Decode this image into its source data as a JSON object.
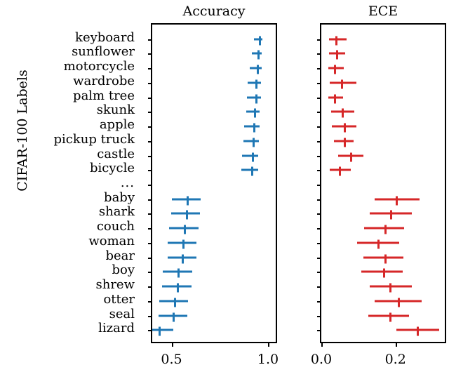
{
  "figure": {
    "ylabel": "CIFAR-100 Labels",
    "background": "#ffffff"
  },
  "panels": [
    {
      "id": "accuracy",
      "title": "Accuracy",
      "color": "#1f77b4",
      "xlim": [
        0.4,
        1.04
      ],
      "xticks": [
        0.5,
        1.0
      ],
      "xticklabels": [
        "0.5",
        "1.0"
      ]
    },
    {
      "id": "ece",
      "title": "ECE",
      "color": "#d62728",
      "xlim": [
        0.0,
        0.333
      ],
      "xticks": [
        0.0,
        0.2
      ],
      "xticklabels": [
        "0.0",
        "0.2"
      ]
    }
  ],
  "chart_data": {
    "type": "scatter",
    "title": "",
    "subtitle": "",
    "ylabel": "CIFAR-100 Labels",
    "xlabel": "",
    "grid": false,
    "legend": null,
    "orientation": "horizontal",
    "marker": "errorbar-with-center-cap",
    "categories": [
      "keyboard",
      "sunflower",
      "motorcycle",
      "wardrobe",
      "palm tree",
      "skunk",
      "apple",
      "pickup truck",
      "castle",
      "bicycle",
      "...",
      "baby",
      "shark",
      "couch",
      "woman",
      "bear",
      "boy",
      "shrew",
      "otter",
      "seal",
      "lizard"
    ],
    "gap_after_index": 9,
    "panels": [
      {
        "name": "Accuracy",
        "color": "#1f77b4",
        "xlim": [
          0.4,
          1.04
        ],
        "xticks": [
          0.5,
          1.0
        ],
        "xticklabels": [
          "0.5",
          "1.0"
        ],
        "points": [
          {
            "label": "keyboard",
            "value": 0.953,
            "low": 0.928,
            "high": 0.971
          },
          {
            "label": "sunflower",
            "value": 0.947,
            "low": 0.918,
            "high": 0.968
          },
          {
            "label": "motorcycle",
            "value": 0.943,
            "low": 0.906,
            "high": 0.966
          },
          {
            "label": "wardrobe",
            "value": 0.935,
            "low": 0.893,
            "high": 0.962
          },
          {
            "label": "palm tree",
            "value": 0.934,
            "low": 0.89,
            "high": 0.963
          },
          {
            "label": "skunk",
            "value": 0.929,
            "low": 0.887,
            "high": 0.958
          },
          {
            "label": "apple",
            "value": 0.924,
            "low": 0.875,
            "high": 0.955
          },
          {
            "label": "pickup truck",
            "value": 0.921,
            "low": 0.871,
            "high": 0.952
          },
          {
            "label": "castle",
            "value": 0.916,
            "low": 0.866,
            "high": 0.949
          },
          {
            "label": "bicycle",
            "value": 0.913,
            "low": 0.862,
            "high": 0.948
          },
          {
            "label": "baby",
            "value": 0.578,
            "low": 0.502,
            "high": 0.65
          },
          {
            "label": "shark",
            "value": 0.575,
            "low": 0.498,
            "high": 0.648
          },
          {
            "label": "couch",
            "value": 0.565,
            "low": 0.489,
            "high": 0.64
          },
          {
            "label": "woman",
            "value": 0.556,
            "low": 0.481,
            "high": 0.63
          },
          {
            "label": "bear",
            "value": 0.553,
            "low": 0.479,
            "high": 0.628
          },
          {
            "label": "boy",
            "value": 0.531,
            "low": 0.455,
            "high": 0.607
          },
          {
            "label": "shrew",
            "value": 0.526,
            "low": 0.451,
            "high": 0.602
          },
          {
            "label": "otter",
            "value": 0.511,
            "low": 0.437,
            "high": 0.587
          },
          {
            "label": "seal",
            "value": 0.505,
            "low": 0.431,
            "high": 0.581
          },
          {
            "label": "lizard",
            "value": 0.432,
            "low": 0.4,
            "high": 0.508
          }
        ]
      },
      {
        "name": "ECE",
        "color": "#d62728",
        "xlim": [
          0.0,
          0.333
        ],
        "xticks": [
          0.0,
          0.2
        ],
        "xticklabels": [
          "0.0",
          "0.2"
        ],
        "points": [
          {
            "label": "keyboard",
            "value": 0.037,
            "low": 0.02,
            "high": 0.069
          },
          {
            "label": "sunflower",
            "value": 0.039,
            "low": 0.021,
            "high": 0.064
          },
          {
            "label": "motorcycle",
            "value": 0.035,
            "low": 0.018,
            "high": 0.06
          },
          {
            "label": "wardrobe",
            "value": 0.053,
            "low": 0.023,
            "high": 0.094
          },
          {
            "label": "palm tree",
            "value": 0.035,
            "low": 0.018,
            "high": 0.058
          },
          {
            "label": "skunk",
            "value": 0.055,
            "low": 0.026,
            "high": 0.089
          },
          {
            "label": "apple",
            "value": 0.06,
            "low": 0.028,
            "high": 0.094
          },
          {
            "label": "pickup truck",
            "value": 0.06,
            "low": 0.034,
            "high": 0.087
          },
          {
            "label": "castle",
            "value": 0.078,
            "low": 0.046,
            "high": 0.113
          },
          {
            "label": "bicycle",
            "value": 0.047,
            "low": 0.022,
            "high": 0.08
          },
          {
            "label": "baby",
            "value": 0.201,
            "low": 0.144,
            "high": 0.264
          },
          {
            "label": "shark",
            "value": 0.185,
            "low": 0.13,
            "high": 0.245
          },
          {
            "label": "couch",
            "value": 0.171,
            "low": 0.116,
            "high": 0.224
          },
          {
            "label": "woman",
            "value": 0.151,
            "low": 0.097,
            "high": 0.21
          },
          {
            "label": "bear",
            "value": 0.171,
            "low": 0.113,
            "high": 0.222
          },
          {
            "label": "boy",
            "value": 0.167,
            "low": 0.108,
            "high": 0.219
          },
          {
            "label": "shrew",
            "value": 0.184,
            "low": 0.13,
            "high": 0.245
          },
          {
            "label": "otter",
            "value": 0.206,
            "low": 0.144,
            "high": 0.27
          },
          {
            "label": "seal",
            "value": 0.183,
            "low": 0.127,
            "high": 0.237
          },
          {
            "label": "lizard",
            "value": 0.257,
            "low": 0.203,
            "high": 0.318
          }
        ]
      }
    ]
  }
}
